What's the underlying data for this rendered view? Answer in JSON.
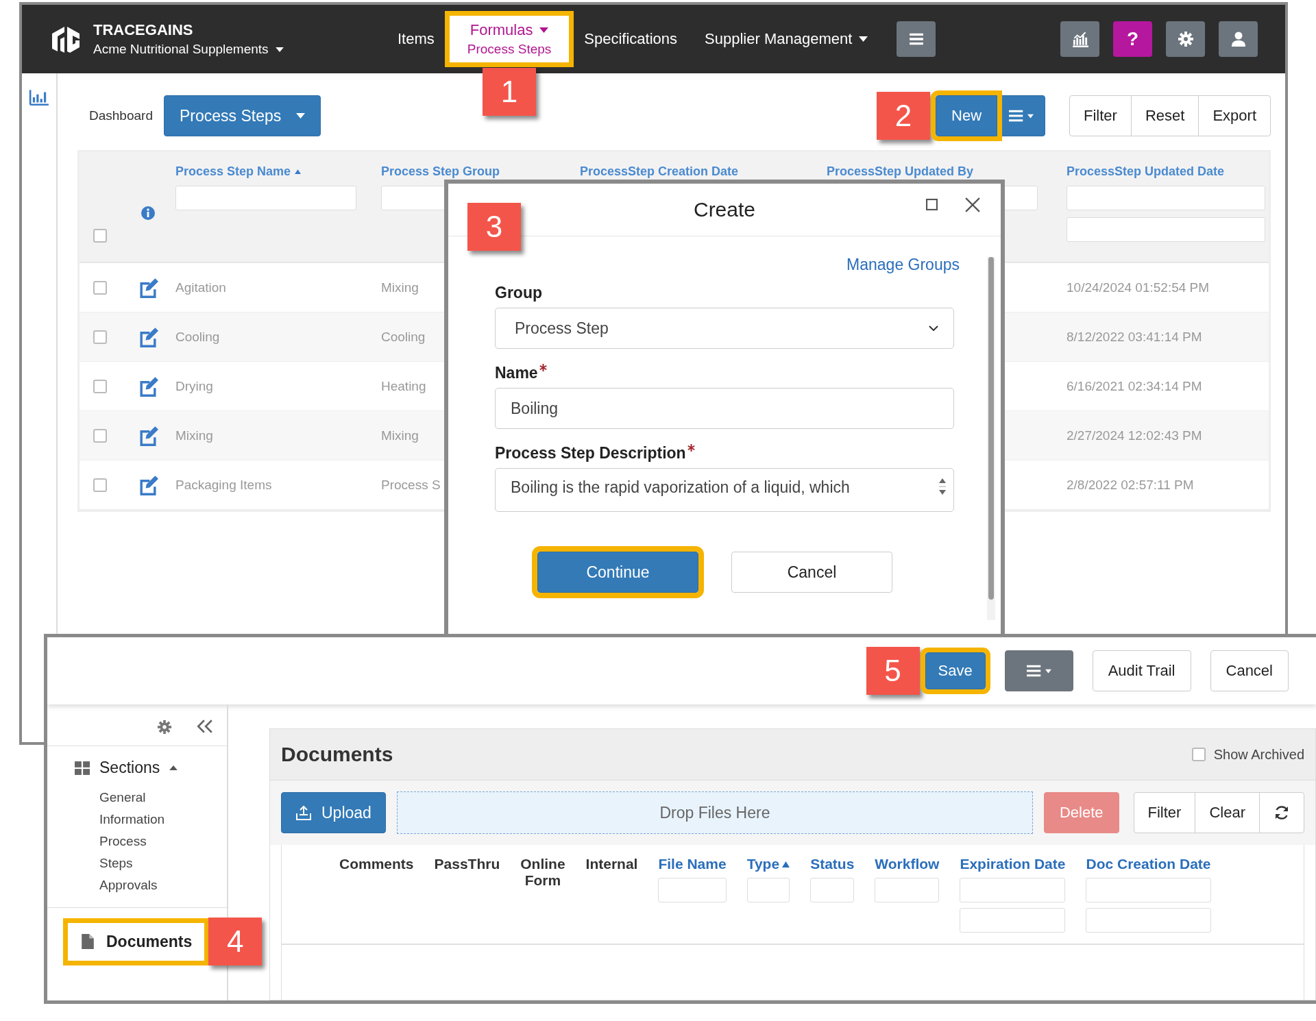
{
  "top_window": {
    "brand": {
      "name": "TRACEGAINS",
      "organization": "Acme Nutritional Supplements"
    },
    "nav": [
      {
        "label": "Items",
        "dropdown": false,
        "selected": false,
        "highlighted": false
      },
      {
        "label": "Formulas",
        "dropdown": true,
        "selected": true,
        "highlighted": true,
        "sublabel": "Process Steps",
        "callout": "1"
      },
      {
        "label": "Specifications",
        "dropdown": false,
        "selected": false,
        "highlighted": false
      },
      {
        "label": "Supplier Management",
        "dropdown": true,
        "selected": false,
        "highlighted": false
      }
    ],
    "header_icons": [
      {
        "kind": "chart"
      },
      {
        "kind": "help",
        "label": "?"
      },
      {
        "kind": "settings"
      },
      {
        "kind": "user"
      }
    ],
    "breadcrumb": "Dashboard",
    "view_selector": "Process Steps",
    "new_button": {
      "label": "New",
      "highlighted": true,
      "callout": "2"
    },
    "actions": [
      "Filter",
      "Reset",
      "Export"
    ],
    "table": {
      "select_all_checked": false,
      "columns": [
        {
          "label": "Process Step Name",
          "sorted": true,
          "kind": "text"
        },
        {
          "label": "Process Step Group",
          "sorted": false,
          "kind": "text"
        },
        {
          "label": "ProcessStep Creation Date",
          "sorted": false,
          "kind": "plain"
        },
        {
          "label": "ProcessStep Updated By",
          "sorted": false,
          "kind": "text"
        },
        {
          "label": "ProcessStep Updated Date",
          "sorted": false,
          "kind": "date"
        }
      ],
      "rows": [
        {
          "checked": false,
          "name": "Agitation",
          "group": "Mixing",
          "updated_date": "10/24/2024 01:52:54 PM"
        },
        {
          "checked": false,
          "name": "Cooling",
          "group": "Cooling",
          "updated_date": "8/12/2022 03:41:14 PM"
        },
        {
          "checked": false,
          "name": "Drying",
          "group": "Heating",
          "updated_date": "6/16/2021 02:34:14 PM"
        },
        {
          "checked": false,
          "name": "Mixing",
          "group": "Mixing",
          "updated_date": "2/27/2024 12:02:43 PM"
        },
        {
          "checked": false,
          "name": "Packaging Items",
          "group": "Process S",
          "updated_date": "2/8/2022 02:57:11 PM"
        }
      ]
    }
  },
  "dialog": {
    "title": "Create",
    "callout": "3",
    "manage_link": "Manage Groups",
    "fields": [
      {
        "kind": "select",
        "label": "Group",
        "required": false,
        "value": "Process Step"
      },
      {
        "kind": "text",
        "label": "Name",
        "required": true,
        "value": "Boiling"
      },
      {
        "kind": "textarea",
        "label": "Process Step Description",
        "required": true,
        "value": "Boiling is the rapid vaporization of a liquid, which"
      }
    ],
    "buttons": [
      {
        "label": "Continue",
        "primary": true,
        "highlighted": true
      },
      {
        "label": "Cancel",
        "primary": false,
        "highlighted": false
      }
    ]
  },
  "bottom_window": {
    "toolbar": [
      {
        "kind": "save",
        "label": "Save",
        "highlighted": true,
        "callout": "5"
      },
      {
        "kind": "menu"
      },
      {
        "kind": "plain",
        "label": "Audit Trail"
      },
      {
        "kind": "plain",
        "label": "Cancel"
      }
    ],
    "sidebar": {
      "sections": {
        "label": "Sections",
        "expanded": true,
        "items": [
          "General Information",
          "Process Steps",
          "Approvals"
        ]
      },
      "documents": {
        "label": "Documents",
        "highlighted": true,
        "callout": "4"
      }
    },
    "documents_panel": {
      "title": "Documents",
      "show_archived": {
        "label": "Show Archived",
        "checked": false
      },
      "upload": "Upload",
      "drop_zone": "Drop Files Here",
      "delete": {
        "label": "Delete",
        "disabled": true
      },
      "actions": [
        "Filter",
        "Clear"
      ],
      "columns": [
        {
          "label": "Comments",
          "kind": "plain",
          "sorted": false
        },
        {
          "label": "PassThru",
          "kind": "plain",
          "sorted": false
        },
        {
          "label": "Online Form",
          "kind": "plain",
          "sorted": false
        },
        {
          "label": "Internal",
          "kind": "plain",
          "sorted": false
        },
        {
          "label": "File Name",
          "kind": "filter",
          "sorted": false
        },
        {
          "label": "Type",
          "kind": "filter",
          "sorted": true
        },
        {
          "label": "Status",
          "kind": "filter",
          "sorted": false
        },
        {
          "label": "Workflow",
          "kind": "filter",
          "sorted": false
        },
        {
          "label": "Expiration Date",
          "kind": "date_filter",
          "sorted": false
        },
        {
          "label": "Doc Creation Date",
          "kind": "date_filter",
          "sorted": false
        }
      ]
    }
  }
}
